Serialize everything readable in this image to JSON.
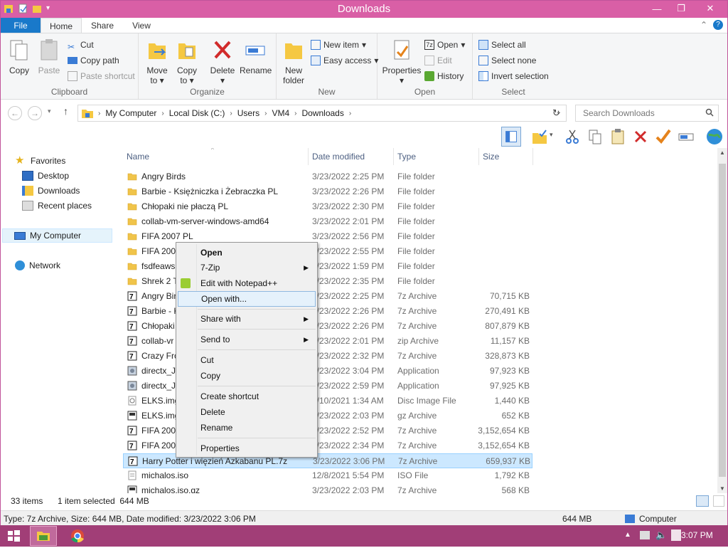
{
  "window": {
    "title": "Downloads"
  },
  "tabs": {
    "file": "File",
    "home": "Home",
    "share": "Share",
    "view": "View"
  },
  "ribbon": {
    "clipboard": {
      "label": "Clipboard",
      "copy": "Copy",
      "paste": "Paste",
      "cut": "Cut",
      "copy_path": "Copy path",
      "paste_shortcut": "Paste shortcut"
    },
    "organize": {
      "label": "Organize",
      "move_to": "Move",
      "move_to2": "to",
      "copy_to": "Copy",
      "copy_to2": "to",
      "delete": "Delete",
      "rename": "Rename"
    },
    "new": {
      "label": "New",
      "new_folder": "New",
      "new_folder2": "folder",
      "new_item": "New item",
      "easy_access": "Easy access"
    },
    "open": {
      "label": "Open",
      "properties": "Properties",
      "open": "Open",
      "edit": "Edit",
      "history": "History"
    },
    "select": {
      "label": "Select",
      "select_all": "Select all",
      "select_none": "Select none",
      "invert": "Invert selection"
    }
  },
  "address": {
    "crumbs": [
      "My Computer",
      "Local Disk (C:)",
      "Users",
      "VM4",
      "Downloads"
    ],
    "search_placeholder": "Search Downloads"
  },
  "navpane": {
    "favorites": "Favorites",
    "desktop": "Desktop",
    "downloads": "Downloads",
    "recent": "Recent places",
    "computer": "My Computer",
    "network": "Network"
  },
  "columns": {
    "name": "Name",
    "date": "Date modified",
    "type": "Type",
    "size": "Size"
  },
  "files": [
    {
      "name": "Angry Birds",
      "date": "3/23/2022 2:25 PM",
      "type": "File folder",
      "size": "",
      "icon": "folder"
    },
    {
      "name": "Barbie - Księżniczka i Żebraczka PL",
      "date": "3/23/2022 2:26 PM",
      "type": "File folder",
      "size": "",
      "icon": "folder"
    },
    {
      "name": "Chłopaki nie płaczą PL",
      "date": "3/23/2022 2:30 PM",
      "type": "File folder",
      "size": "",
      "icon": "folder"
    },
    {
      "name": "collab-vm-server-windows-amd64",
      "date": "3/23/2022 2:01 PM",
      "type": "File folder",
      "size": "",
      "icon": "folder"
    },
    {
      "name": "FIFA 2007 PL",
      "date": "3/23/2022 2:56 PM",
      "type": "File folder",
      "size": "",
      "icon": "folder"
    },
    {
      "name": "FIFA 2007",
      "date": "3/23/2022 2:55 PM",
      "type": "File folder",
      "size": "",
      "icon": "folder"
    },
    {
      "name": "fsdfeaws",
      "date": "3/23/2022 1:59 PM",
      "type": "File folder",
      "size": "",
      "icon": "folder"
    },
    {
      "name": "Shrek 2 T",
      "date": "3/23/2022 2:35 PM",
      "type": "File folder",
      "size": "",
      "icon": "folder"
    },
    {
      "name": "Angry Bir",
      "date": "3/23/2022 2:25 PM",
      "type": "7z Archive",
      "size": "70,715 KB",
      "icon": "7z"
    },
    {
      "name": "Barbie - K",
      "date": "3/23/2022 2:26 PM",
      "type": "7z Archive",
      "size": "270,491 KB",
      "icon": "7z"
    },
    {
      "name": "Chłopaki",
      "date": "3/23/2022 2:26 PM",
      "type": "7z Archive",
      "size": "807,879 KB",
      "icon": "7z"
    },
    {
      "name": "collab-vr",
      "date": "3/23/2022 2:01 PM",
      "type": "zip Archive",
      "size": "11,157 KB",
      "icon": "7z"
    },
    {
      "name": "Crazy Fro",
      "date": "3/23/2022 2:32 PM",
      "type": "7z Archive",
      "size": "328,873 KB",
      "icon": "7z"
    },
    {
      "name": "directx_Ju",
      "date": "3/23/2022 3:04 PM",
      "type": "Application",
      "size": "97,923 KB",
      "icon": "app"
    },
    {
      "name": "directx_Ju",
      "date": "3/23/2022 2:59 PM",
      "type": "Application",
      "size": "97,925 KB",
      "icon": "app"
    },
    {
      "name": "ELKS.img",
      "date": "2/10/2021 1:34 AM",
      "type": "Disc Image File",
      "size": "1,440 KB",
      "icon": "disc"
    },
    {
      "name": "ELKS.img",
      "date": "3/23/2022 2:03 PM",
      "type": "gz Archive",
      "size": "652 KB",
      "icon": "gz"
    },
    {
      "name": "FIFA 2007",
      "date": "3/23/2022 2:52 PM",
      "type": "7z Archive",
      "size": "3,152,654 KB",
      "icon": "7z"
    },
    {
      "name": "FIFA 2007",
      "date": "3/23/2022 2:34 PM",
      "type": "7z Archive",
      "size": "3,152,654 KB",
      "icon": "7z"
    },
    {
      "name": "Harry Potter i więzień Azkabanu PL.7z",
      "date": "3/23/2022 3:06 PM",
      "type": "7z Archive",
      "size": "659,937 KB",
      "icon": "7z"
    },
    {
      "name": "michalos.iso",
      "date": "12/8/2021 5:54 PM",
      "type": "ISO File",
      "size": "1,792 KB",
      "icon": "iso"
    },
    {
      "name": "michalos.iso.gz",
      "date": "3/23/2022 2:03 PM",
      "type": "7z Archive",
      "size": "568 KB",
      "icon": "gz"
    }
  ],
  "selected_index": 19,
  "context_menu": {
    "open": "Open",
    "zip": "7-Zip",
    "notepad": "Edit with Notepad++",
    "open_with": "Open with...",
    "share_with": "Share with",
    "send_to": "Send to",
    "cut": "Cut",
    "copy": "Copy",
    "create_shortcut": "Create shortcut",
    "delete": "Delete",
    "rename": "Rename",
    "properties": "Properties"
  },
  "status": {
    "items": "33 items",
    "selected": "1 item selected  644 MB"
  },
  "details": {
    "info": "Type: 7z Archive, Size: 644 MB, Date modified: 3/23/2022 3:06 PM",
    "size": "644 MB",
    "location": "Computer"
  },
  "taskbar": {
    "time": "3:07 PM"
  },
  "colors": {
    "accent": "#d95fa6",
    "taskbar": "#a13e77",
    "file_tab": "#1979ca",
    "selection": "#cce8ff"
  }
}
